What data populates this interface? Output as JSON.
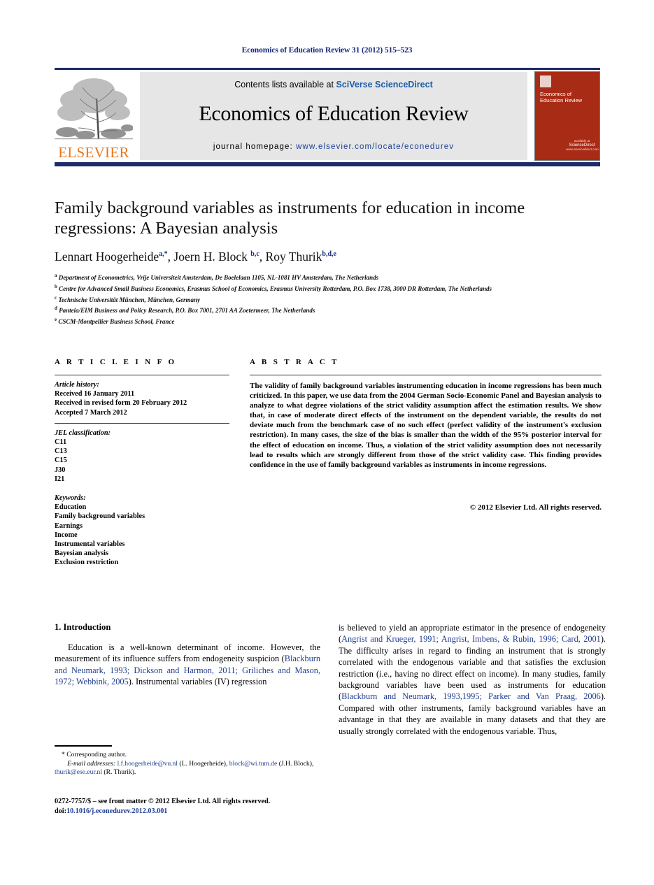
{
  "running_head": "Economics of Education Review 31 (2012) 515–523",
  "banner": {
    "publisher": "ELSEVIER",
    "contents_prefix": "Contents lists available at ",
    "contents_link": "SciVerse ScienceDirect",
    "journal_title": "Economics of Education Review",
    "homepage_prefix": "journal homepage: ",
    "homepage_url": "www.elsevier.com/locate/econedurev",
    "cover_title": "Economics of Education Review",
    "cover_sd_small": "available at",
    "cover_sd_big": "ScienceDirect",
    "cover_sd_foot": "www.sciencedirect.com"
  },
  "article": {
    "title": "Family background variables as instruments for education in income regressions: A Bayesian analysis",
    "authors_html": "Lennart Hoogerheide<sup>a,*</sup>, Joern H. Block <sup>b,c</sup>, Roy Thurik<sup>b,d,e</sup>",
    "affiliations": [
      {
        "marker": "a",
        "text": "Department of Econometrics, Vrije Universiteit Amsterdam, De Boelelaan 1105, NL-1081 HV Amsterdam, The Netherlands"
      },
      {
        "marker": "b",
        "text": "Centre for Advanced Small Business Economics, Erasmus School of Economics, Erasmus University Rotterdam, P.O. Box 1738, 3000 DR Rotterdam, The Netherlands"
      },
      {
        "marker": "c",
        "text": "Technische Universität München, München, Germany"
      },
      {
        "marker": "d",
        "text": "Panteia/EIM Business and Policy Research, P.O. Box 7001, 2701 AA Zoetermeer, The Netherlands"
      },
      {
        "marker": "e",
        "text": "CSCM-Montpellier Business School, France"
      }
    ]
  },
  "article_info": {
    "heading": "A R T I C L E   I N F O",
    "history_label": "Article history:",
    "history": [
      "Received 16 January 2011",
      "Received in revised form 20 February 2012",
      "Accepted 7 March 2012"
    ],
    "jel_label": "JEL classification:",
    "jel": [
      "C11",
      "C13",
      "C15",
      "J30",
      "I21"
    ],
    "keywords_label": "Keywords:",
    "keywords": [
      "Education",
      "Family background variables",
      "Earnings",
      "Income",
      "Instrumental variables",
      "Bayesian analysis",
      "Exclusion restriction"
    ]
  },
  "abstract": {
    "heading": "A B S T R A C T",
    "text": "The validity of family background variables instrumenting education in income regressions has been much criticized. In this paper, we use data from the 2004 German Socio-Economic Panel and Bayesian analysis to analyze to what degree violations of the strict validity assumption affect the estimation results. We show that, in case of moderate direct effects of the instrument on the dependent variable, the results do not deviate much from the benchmark case of no such effect (perfect validity of the instrument's exclusion restriction). In many cases, the size of the bias is smaller than the width of the 95% posterior interval for the effect of education on income. Thus, a violation of the strict validity assumption does not necessarily lead to results which are strongly different from those of the strict validity case. This finding provides confidence in the use of family background variables as instruments in income regressions.",
    "copyright": "© 2012 Elsevier Ltd. All rights reserved."
  },
  "body": {
    "section_number_title": "1.  Introduction",
    "left_p1_a": "Education is a well-known determinant of income. However, the measurement of its influence suffers from endogeneity suspicion (",
    "left_p1_refs": "Blackburn and Neumark, 1993; Dickson and Harmon, 2011; Griliches and Mason, 1972; Webbink, 2005",
    "left_p1_b": "). Instrumental variables (IV) regression",
    "right_p1_a": "is believed to yield an appropriate estimator in the presence of endogeneity (",
    "right_p1_refs1": "Angrist and Krueger, 1991; Angrist, Imbens, & Rubin, 1996; Card, 2001",
    "right_p1_b": "). The difficulty arises in regard to finding an instrument that is strongly correlated with the endogenous variable and that satisfies the exclusion restriction (i.e., having no direct effect on income). In many studies, family background variables have been used as instruments for education (",
    "right_p1_refs2": "Blackburn and Neumark, 1993,1995; Parker and Van Praag, 2006",
    "right_p1_c": "). Compared with other instruments, family background variables have an advantage in that they are available in many datasets and that they are usually strongly correlated with the endogenous variable. Thus,"
  },
  "footnotes": {
    "corresponding": "*  Corresponding author.",
    "email_label": "E-mail addresses:",
    "emails": [
      {
        "addr": "l.f.hoogerheide@vu.nl",
        "who": " (L. Hoogerheide),"
      },
      {
        "addr": "block@wi.tum.de",
        "who": " (J.H. Block),"
      },
      {
        "addr": "thurik@ese.eur.nl",
        "who": " (R. Thurik)."
      }
    ],
    "issn_line": "0272-7757/$ – see front matter © 2012 Elsevier Ltd. All rights reserved.",
    "doi_label": "doi:",
    "doi": "10.1016/j.econedurev.2012.03.001"
  },
  "colors": {
    "rule_blue": "#1d2b67",
    "link_blue": "#1f3d91",
    "elsevier_orange": "#e8751a",
    "cover_red": "#a82b16",
    "banner_grey": "#e6e6e6"
  }
}
